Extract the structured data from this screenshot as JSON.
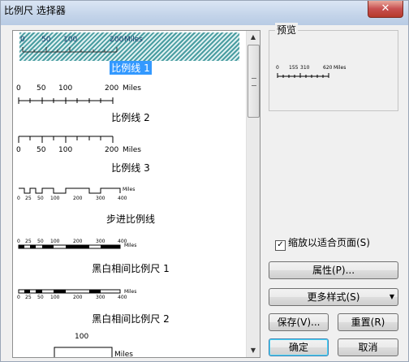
{
  "window": {
    "title": "比例尺 选择器",
    "close_glyph": "✕"
  },
  "list": {
    "items": [
      {
        "label": "比例线 1",
        "ticks": [
          "0",
          "50",
          "100",
          "200"
        ],
        "unit": "Miles",
        "selected": true
      },
      {
        "label": "比例线 2",
        "ticks": [
          "0",
          "50",
          "100",
          "200"
        ],
        "unit": "Miles"
      },
      {
        "label": "比例线 3",
        "ticks": [
          "0",
          "50",
          "100",
          "200"
        ],
        "unit": "Miles"
      },
      {
        "label": "步进比例线",
        "ticks": [
          "0",
          "25",
          "50",
          "100",
          "200",
          "300",
          "400"
        ],
        "unit": "Miles"
      },
      {
        "label": "黑白相间比例尺 1",
        "ticks": [
          "0",
          "25",
          "50",
          "100",
          "200",
          "300",
          "400"
        ],
        "unit": "Miles"
      },
      {
        "label": "黑白相间比例尺 2",
        "ticks": [
          "0",
          "25",
          "50",
          "100",
          "200",
          "300",
          "400"
        ],
        "unit": "Miles"
      },
      {
        "label": "",
        "ticks": [
          "100"
        ],
        "unit": "Miles"
      }
    ]
  },
  "preview": {
    "label": "预览",
    "ticks": [
      "0",
      "155",
      "310",
      "620"
    ],
    "unit": "Miles"
  },
  "fit_to_page": {
    "label": "缩放以适合页面(S)",
    "checked": true
  },
  "buttons": {
    "properties": "属性(P)...",
    "more_styles": "更多样式(S)",
    "save": "保存(V)...",
    "reset": "重置(R)",
    "ok": "确定",
    "cancel": "取消"
  },
  "colors": {
    "selection": "#3399ff",
    "hatch": "#4a9da1",
    "close": "#c75050"
  }
}
